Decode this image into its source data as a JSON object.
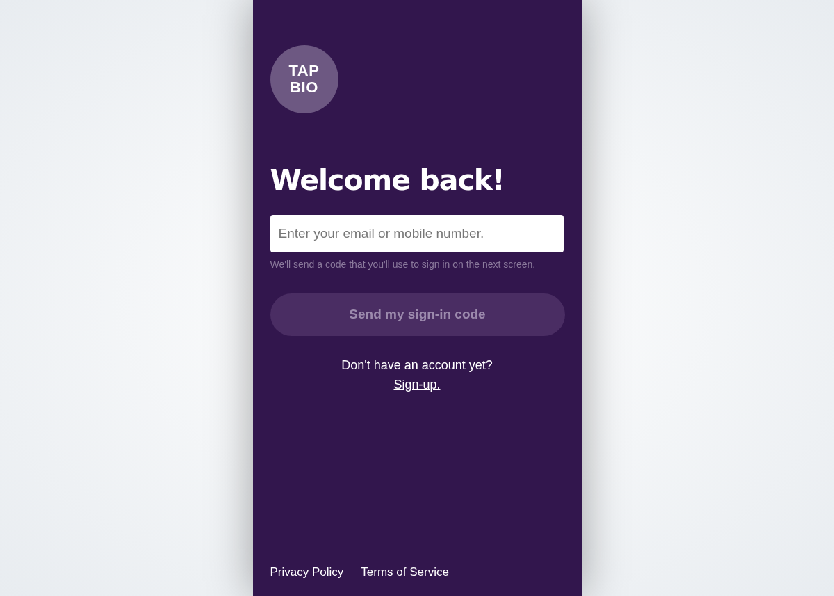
{
  "logo": {
    "lines": [
      "TAP",
      "BIO"
    ]
  },
  "heading": "Welcome back!",
  "login_field": {
    "placeholder": "Enter your email or mobile number."
  },
  "hint": "We'll send a code that you'll use to sign in on the next screen.",
  "submit_button": {
    "label": "Send my sign-in code",
    "disabled": true
  },
  "signup_prompt": "Don't have an account yet?",
  "signup_link": "Sign-up.",
  "footer_links": [
    "Privacy Policy",
    "Terms of Service"
  ]
}
